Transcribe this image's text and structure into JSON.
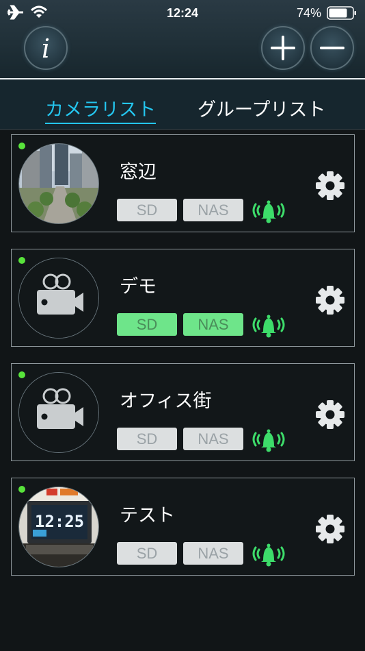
{
  "status_bar": {
    "time": "12:24",
    "battery": "74%"
  },
  "header": {
    "info_label": "i"
  },
  "tabs": {
    "camera_list": "カメラリスト",
    "group_list": "グループリスト"
  },
  "cameras": [
    {
      "name": "窓辺",
      "sd": "SD",
      "nas": "NAS",
      "sd_active": false,
      "nas_active": false,
      "online": true,
      "thumbnail": "street-photo"
    },
    {
      "name": "デモ",
      "sd": "SD",
      "nas": "NAS",
      "sd_active": true,
      "nas_active": true,
      "online": true,
      "thumbnail": "camera-icon"
    },
    {
      "name": "オフィス街",
      "sd": "SD",
      "nas": "NAS",
      "sd_active": false,
      "nas_active": false,
      "online": true,
      "thumbnail": "camera-icon"
    },
    {
      "name": "テスト",
      "sd": "SD",
      "nas": "NAS",
      "sd_active": false,
      "nas_active": false,
      "online": true,
      "thumbnail": "clock-photo"
    }
  ],
  "clock_display": "12:25",
  "colors": {
    "accent": "#24c6ef",
    "online": "#58e33b",
    "active_badge": "#6ee58a",
    "bell": "#3ddc6a"
  }
}
